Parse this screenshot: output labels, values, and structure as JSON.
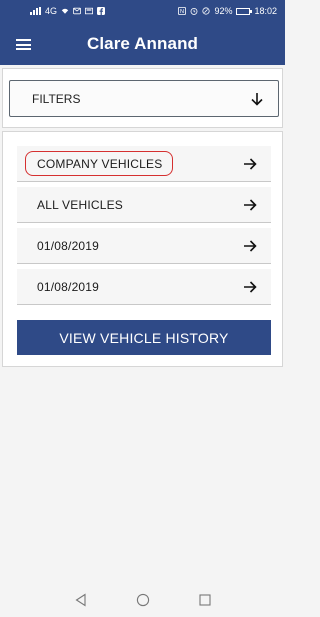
{
  "status_bar": {
    "left_text": "4G",
    "battery": "92%",
    "time": "18:02",
    "battery_level": 0.92
  },
  "app_bar": {
    "title": "Clare Annand",
    "menu_icon": "hamburger-menu-icon"
  },
  "filters": {
    "label": "FILTERS",
    "icon": "arrow-down-icon"
  },
  "list": {
    "items": [
      {
        "label": "COMPANY VEHICLES",
        "icon": "arrow-right-icon",
        "highlighted": true
      },
      {
        "label": "ALL VEHICLES",
        "icon": "arrow-right-icon",
        "highlighted": false
      },
      {
        "label": "01/08/2019",
        "icon": "arrow-right-icon",
        "highlighted": false
      },
      {
        "label": "01/08/2019",
        "icon": "arrow-right-icon",
        "highlighted": false
      }
    ]
  },
  "history_button": {
    "label": "VIEW VEHICLE HISTORY"
  },
  "nav_bar": {
    "icons": [
      "back-triangle-icon",
      "home-circle-icon",
      "recents-square-icon"
    ]
  },
  "colors": {
    "primary": "#2f4a87",
    "highlight": "#d53030",
    "background": "#f4f4f4"
  }
}
